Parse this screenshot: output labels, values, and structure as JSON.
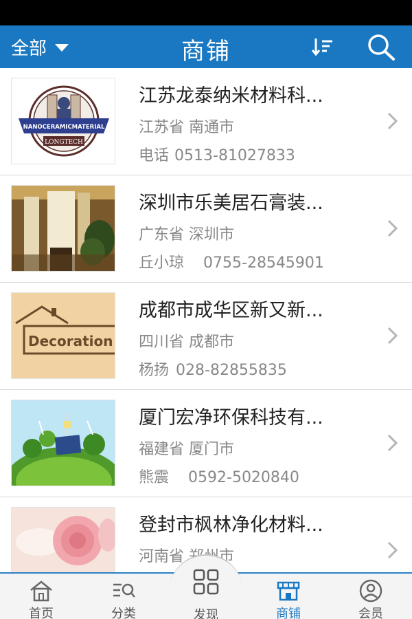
{
  "header": {
    "filter_label": "全部",
    "title": "商铺",
    "sort_icon": "sort-icon",
    "search_icon": "search-icon",
    "accent_color": "#1a78c2"
  },
  "shops": [
    {
      "name": "江苏龙泰纳米材料科...",
      "region": "江苏省 南通市",
      "contact_name": "电话",
      "phone": "0513-81027833",
      "logo_text": "NANOCERAMICMATERIAL",
      "logo_sub": "LONGTECH"
    },
    {
      "name": "深圳市乐美居石膏装...",
      "region": "广东省 深圳市",
      "contact_name": "丘小琼",
      "phone": "0755-28545901"
    },
    {
      "name": "成都市成华区新又新...",
      "region": "四川省 成都市",
      "contact_name": "杨扬",
      "phone": "028-82855835",
      "logo_text": "Decoration"
    },
    {
      "name": "厦门宏净环保科技有...",
      "region": "福建省 厦门市",
      "contact_name": "熊震",
      "phone": "0592-5020840"
    },
    {
      "name": "登封市枫林净化材料...",
      "region": "河南省 郑州市",
      "contact_name": "",
      "phone": ""
    }
  ],
  "tabbar": {
    "home": "首页",
    "category": "分类",
    "discover": "发现",
    "shops": "商铺",
    "member": "会员"
  }
}
